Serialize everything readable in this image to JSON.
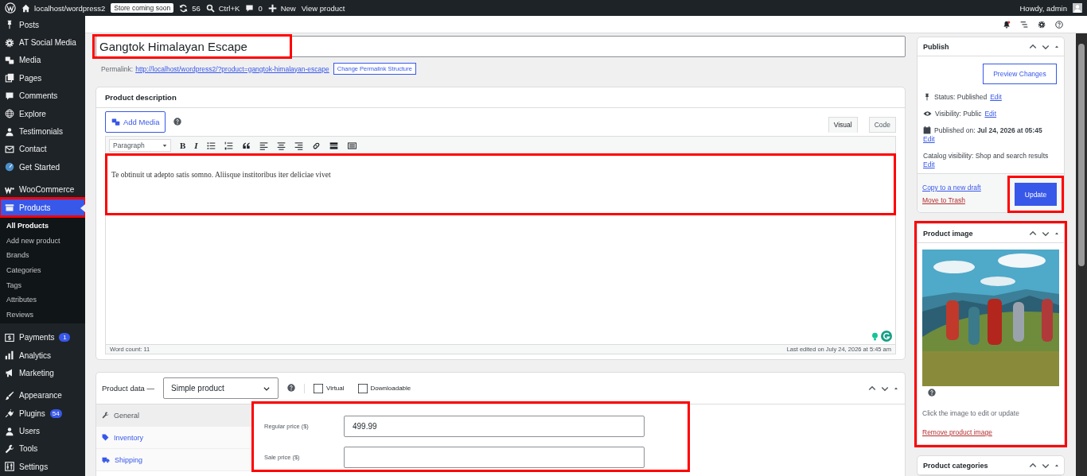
{
  "admin_bar": {
    "site": "localhost/wordpress2",
    "badge": "Store coming soon",
    "updates": "56",
    "search": "Ctrl+K",
    "comments": "0",
    "new": "New",
    "view": "View product",
    "greeting": "Howdy, admin"
  },
  "sidebar": {
    "groups": [
      [
        {
          "label": "Posts",
          "selected": false
        },
        {
          "label": "AT Social Media",
          "selected": false
        },
        {
          "label": "Media",
          "selected": false
        },
        {
          "label": "Pages",
          "selected": false
        },
        {
          "label": "Comments",
          "selected": false
        },
        {
          "label": "Explore",
          "selected": false
        },
        {
          "label": "Testimonials",
          "selected": false
        },
        {
          "label": "Contact",
          "selected": false
        },
        {
          "label": "Get Started",
          "selected": false
        }
      ],
      [
        {
          "label": "WooCommerce",
          "selected": false
        },
        {
          "label": "Products",
          "selected": true,
          "highlighted": true,
          "children": [
            {
              "label": "All Products",
              "selected": true
            },
            {
              "label": "Add new product",
              "selected": false
            },
            {
              "label": "Brands",
              "selected": false
            },
            {
              "label": "Categories",
              "selected": false
            },
            {
              "label": "Tags",
              "selected": false
            },
            {
              "label": "Attributes",
              "selected": false
            },
            {
              "label": "Reviews",
              "selected": false
            }
          ]
        }
      ],
      [
        {
          "label": "Payments",
          "selected": false,
          "badge": "1"
        },
        {
          "label": "Analytics",
          "selected": false
        },
        {
          "label": "Marketing",
          "selected": false
        }
      ],
      [
        {
          "label": "Appearance",
          "selected": false
        },
        {
          "label": "Plugins",
          "selected": false,
          "badge": "54"
        },
        {
          "label": "Users",
          "selected": false
        },
        {
          "label": "Tools",
          "selected": false
        },
        {
          "label": "Settings",
          "selected": false
        }
      ]
    ]
  },
  "title": {
    "value": "Gangtok Himalayan Escape",
    "highlighted": true
  },
  "permalink": {
    "label": "Permalink:",
    "url": "http://localhost/wordpress2/?product=gangtok-himalayan-escape",
    "button": "Change Permalink Structure"
  },
  "description": {
    "heading": "Product description",
    "add_media": "Add Media",
    "tabs": [
      {
        "label": "Visual",
        "selected": true
      },
      {
        "label": "Code",
        "selected": false
      }
    ],
    "format": "Paragraph",
    "toolbar": [
      {
        "kind": "bold",
        "text": "B"
      },
      {
        "kind": "italic",
        "text": "I"
      },
      {
        "kind": "bullets"
      },
      {
        "kind": "numbers"
      },
      {
        "kind": "quote"
      },
      {
        "kind": "align-left"
      },
      {
        "kind": "align-center"
      },
      {
        "kind": "align-right"
      },
      {
        "kind": "link"
      },
      {
        "kind": "more"
      },
      {
        "kind": "kitchen-sink"
      }
    ],
    "content": "Te obtinuit ut adepto satis somno. Aliisque institoribus iter deliciae vivet",
    "highlighted": true,
    "word_count": "Word count: 11",
    "last_edited": "Last edited on July 24, 2026 at 5:45 am"
  },
  "product_data": {
    "heading": "Product data —",
    "type": "Simple product",
    "options": [
      {
        "label": "Virtual",
        "checked": false
      },
      {
        "label": "Downloadable",
        "checked": false
      }
    ],
    "tabs": [
      {
        "label": "General",
        "selected": true
      },
      {
        "label": "Inventory",
        "selected": false
      },
      {
        "label": "Shipping",
        "selected": false
      }
    ],
    "fields": [
      {
        "label": "Regular price ($)",
        "value": "499.99"
      },
      {
        "label": "Sale price ($)"
      }
    ],
    "highlighted": true
  },
  "publish": {
    "heading": "Publish",
    "preview": "Preview Changes",
    "rows": [
      {
        "kind": "status",
        "text": "Status: Published",
        "link": "Edit"
      },
      {
        "kind": "visibility",
        "text": "Visibility: Public",
        "link": "Edit"
      },
      {
        "kind": "date",
        "text": "Published on: **Jul 24, 2026 at 05:45**",
        "link": "Edit"
      },
      {
        "kind": "catalog",
        "text": "Catalog visibility: Shop and search results",
        "link": "Edit"
      }
    ],
    "copy": "Copy to a new draft",
    "trash": "Move to Trash",
    "update": {
      "label": "Update",
      "highlighted": true
    }
  },
  "product_image": {
    "heading": "Product image",
    "hint": "Click the image to edit or update",
    "remove": "Remove product image",
    "highlighted": true
  },
  "product_categories": {
    "heading": "Product categories"
  }
}
